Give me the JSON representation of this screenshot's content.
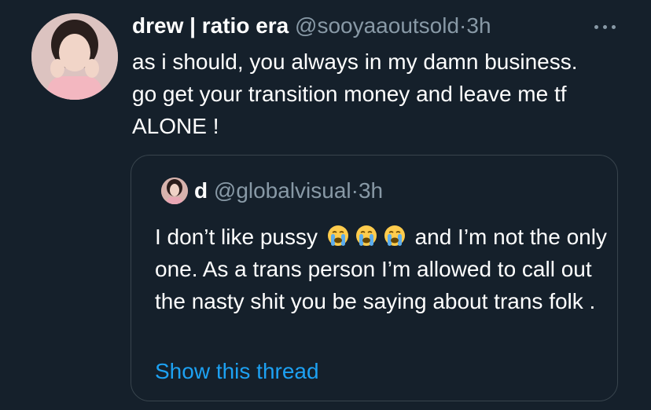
{
  "tweet": {
    "display_name": "drew | ratio era",
    "handle": "@sooyaaoutsold",
    "separator": "·",
    "time": "3h",
    "avatar_icon": "profile-photo-avatar",
    "more_icon": "more-options-icon",
    "text": "as i should, you always in my damn business. go get your transition money and leave me tf ALONE !"
  },
  "quote": {
    "display_name": "d",
    "handle": "@globalvisual",
    "separator": "·",
    "time": "3h",
    "avatar_icon": "profile-photo-avatar",
    "text_before": "I don’t like pussy",
    "emojis": [
      "loudly-crying-face",
      "loudly-crying-face",
      "loudly-crying-face"
    ],
    "text_after": "and I’m not the only one. As a trans person I’m allowed to call out the nasty shit you be saying about trans folk .",
    "show_thread_label": "Show this thread"
  },
  "colors": {
    "background": "#15202b",
    "primary_text": "#ffffff",
    "secondary_text": "#8899a6",
    "border": "#38444d",
    "link": "#1da1f2"
  }
}
